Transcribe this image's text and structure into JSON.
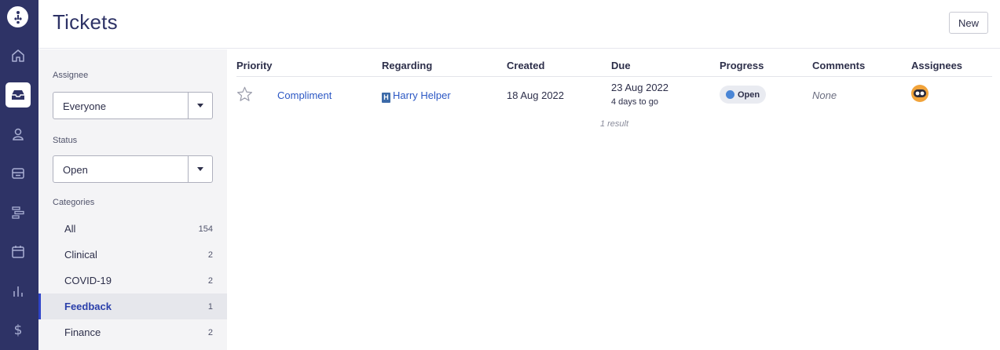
{
  "header": {
    "title": "Tickets",
    "new_label": "New"
  },
  "rail": {
    "items": [
      {
        "icon": "home-icon",
        "active": false
      },
      {
        "icon": "inbox-icon",
        "active": true
      },
      {
        "icon": "person-icon",
        "active": false
      },
      {
        "icon": "store-icon",
        "active": false
      },
      {
        "icon": "timeline-icon",
        "active": false
      },
      {
        "icon": "calendar-icon",
        "active": false
      },
      {
        "icon": "chart-icon",
        "active": false
      },
      {
        "icon": "dollar-icon",
        "active": false
      }
    ]
  },
  "filters": {
    "assignee_label": "Assignee",
    "assignee_value": "Everyone",
    "status_label": "Status",
    "status_value": "Open",
    "categories_label": "Categories",
    "categories": [
      {
        "name": "All",
        "count": "154"
      },
      {
        "name": "Clinical",
        "count": "2"
      },
      {
        "name": "COVID-19",
        "count": "2"
      },
      {
        "name": "Feedback",
        "count": "1",
        "active": true
      },
      {
        "name": "Finance",
        "count": "2"
      }
    ]
  },
  "table": {
    "columns": {
      "priority": "Priority",
      "regarding": "Regarding",
      "created": "Created",
      "due": "Due",
      "progress": "Progress",
      "comments": "Comments",
      "assignees": "Assignees"
    },
    "rows": [
      {
        "title": "Compliment",
        "regarding_badge": "H",
        "regarding": "Harry Helper",
        "created": "18 Aug 2022",
        "due": "23 Aug 2022",
        "due_relative": "4 days to go",
        "status": "Open",
        "comments": "None"
      }
    ],
    "result_count": "1 result"
  },
  "colors": {
    "rail": "#2e3366",
    "accent": "#2f44c9",
    "link": "#2b57c4",
    "avatar": "#f1a33a",
    "status_dot": "#4a86d6"
  }
}
